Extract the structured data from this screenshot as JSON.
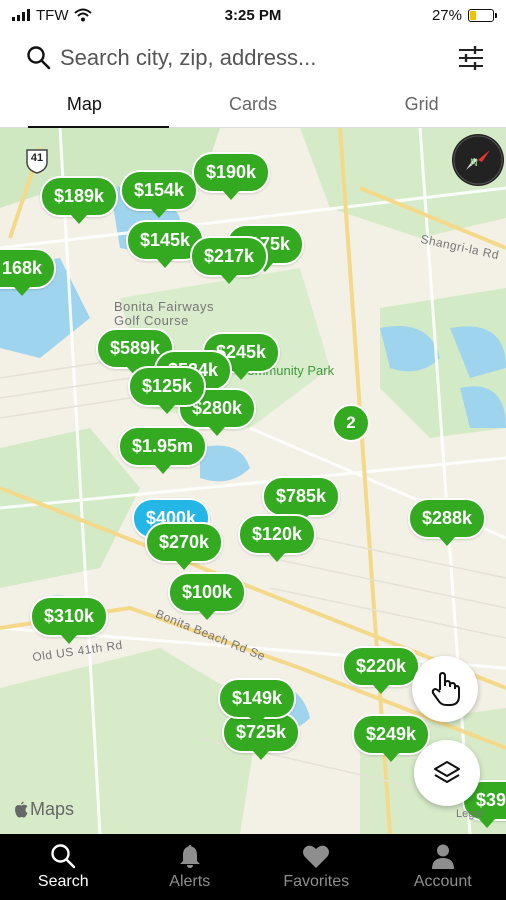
{
  "status": {
    "carrier": "TFW",
    "time": "3:25 PM",
    "battery": "27%",
    "battery_level": 0.27
  },
  "search": {
    "placeholder": "Search city, zip, address..."
  },
  "tabs": [
    {
      "label": "Map",
      "active": true
    },
    {
      "label": "Cards"
    },
    {
      "label": "Grid"
    }
  ],
  "map": {
    "route_shield": "41",
    "labels": {
      "golf": "Bonita Fairways\nGolf Course",
      "park": "Community Park",
      "shangrila": "Shangri-la Rd",
      "bonita_beach": "Bonita Beach Rd Se",
      "old_us41": "Old US 41th Rd",
      "attribution": "Maps",
      "legal": "Legal"
    },
    "pins": [
      "$190k",
      "$189k",
      "$154k",
      "$145k",
      "$217k",
      "$175k",
      "168k",
      "$589k",
      "$245k",
      "$534k",
      "$125k",
      "$280k",
      "$1.95m",
      "$785k",
      "$400k",
      "$270k",
      "$120k",
      "$288k",
      "$100k",
      "$310k",
      "$220k",
      "$149k",
      "$725k",
      "$249k",
      "$39"
    ],
    "cluster": "2",
    "icons": [
      "compass-icon",
      "hand-pointer-icon",
      "layers-icon"
    ]
  },
  "nav": [
    {
      "label": "Search",
      "icon": "search-icon",
      "active": true
    },
    {
      "label": "Alerts",
      "icon": "bell-icon"
    },
    {
      "label": "Favorites",
      "icon": "heart-icon"
    },
    {
      "label": "Account",
      "icon": "person-icon"
    }
  ],
  "colors": {
    "pin": "#33aa1f",
    "pin_selected": "#25b6e8",
    "nav_bg": "#000000"
  }
}
